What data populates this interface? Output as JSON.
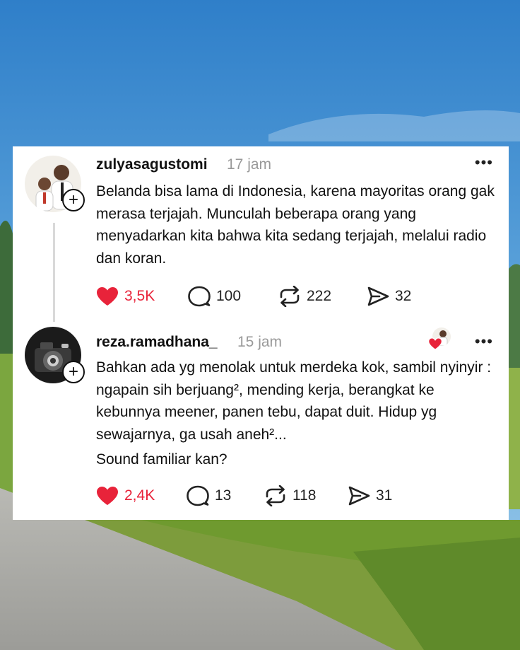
{
  "posts": [
    {
      "username": "zulyasagustomi",
      "time": "17 jam",
      "text": "Belanda bisa lama di Indonesia, karena mayoritas orang gak merasa terjajah. Munculah beberapa orang yang menyadarkan kita bahwa kita sedang terjajah, melalui radio dan koran.",
      "extra": "",
      "likes": "3,5K",
      "replies": "100",
      "reposts": "222",
      "shares": "32"
    },
    {
      "username": "reza.ramadhana_",
      "time": "15 jam",
      "text": "Bahkan ada yg menolak untuk merdeka kok, sambil nyinyir : ngapain sih berjuang², mending kerja, berangkat ke kebunnya meener, panen tebu, dapat duit. Hidup yg sewajarnya, ga usah aneh²...",
      "extra": "Sound familiar kan?",
      "likes": "2,4K",
      "replies": "13",
      "reposts": "118",
      "shares": "31"
    }
  ],
  "icons": {
    "like": "heart-icon",
    "reply": "comment-icon",
    "repost": "repost-icon",
    "share": "send-icon",
    "more": "more-icon",
    "follow": "plus-icon"
  },
  "colors": {
    "like": "#e8233a",
    "time": "#999999",
    "text": "#111111"
  }
}
